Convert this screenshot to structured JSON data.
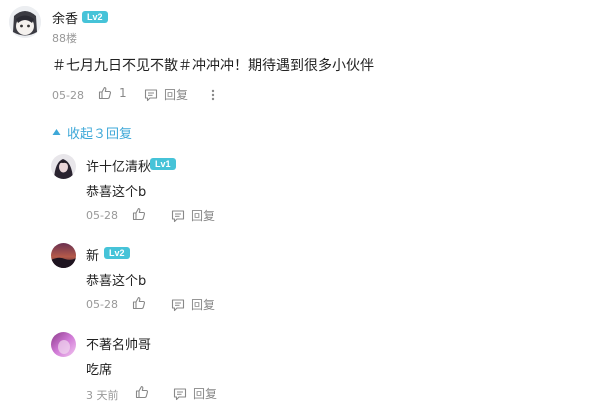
{
  "main_comment": {
    "username": "余香",
    "level": "Lv2",
    "level_color": "#46c3d8",
    "floor": "88楼",
    "text": "＃七月九日不见不散＃冲冲冲！期待遇到很多小伙伴",
    "date": "05-28",
    "like_count": "1",
    "reply_label": "回复",
    "more_icon": "more-vertical-icon"
  },
  "collapse": {
    "label": "收起３回复",
    "icon": "triangle-up-icon"
  },
  "replies": [
    {
      "username": "许十亿清秋",
      "level": "Lv1",
      "level_color": "#46c3d8",
      "text": "恭喜这个b",
      "date": "05-28",
      "reply_label": "回复"
    },
    {
      "username": "新",
      "level": "Lv2",
      "level_color": "#46c3d8",
      "text": "恭喜这个b",
      "date": "05-28",
      "reply_label": "回复"
    },
    {
      "username": "不著名帅哥",
      "level": "",
      "text": "吃席",
      "date": "3 天前",
      "reply_label": "回复"
    }
  ],
  "colors": {
    "accent": "#3ea8d8",
    "meta": "#999999"
  }
}
